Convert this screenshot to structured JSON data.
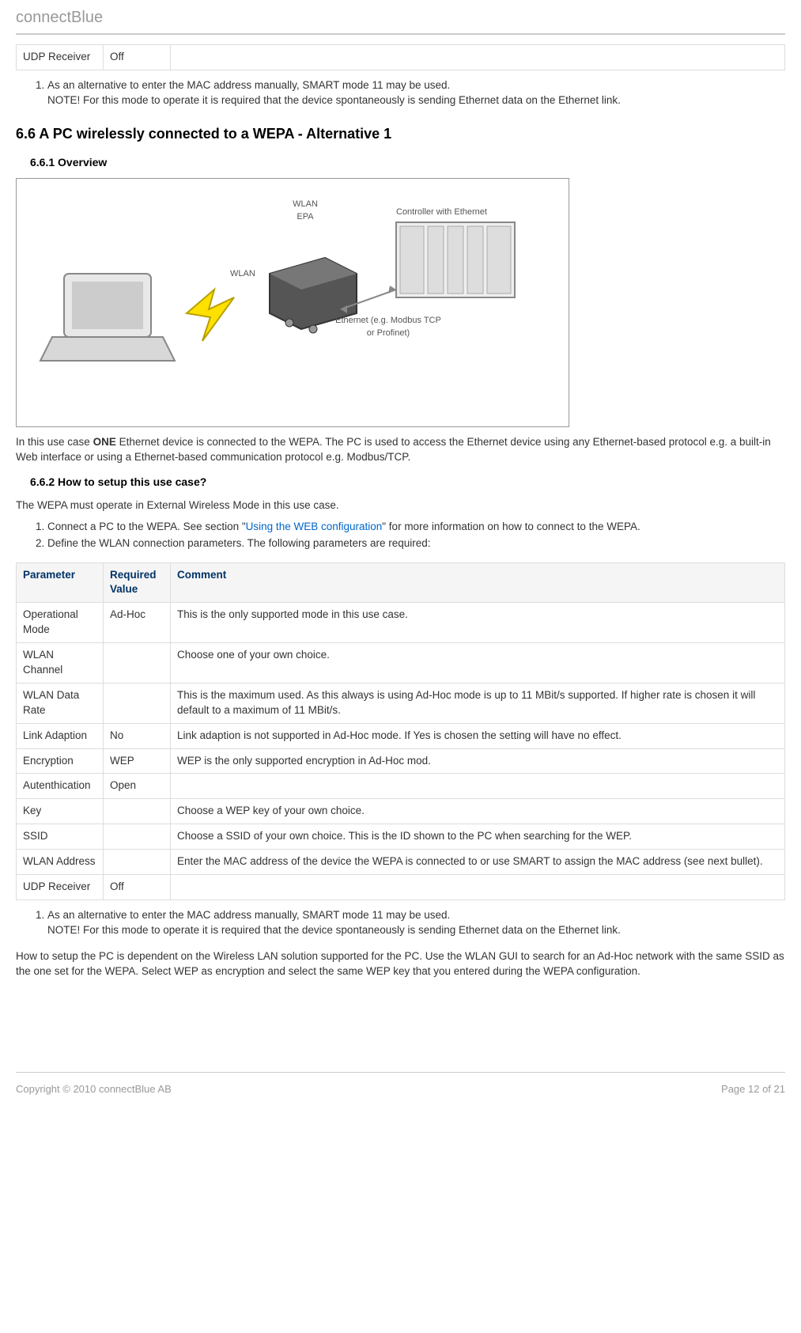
{
  "header": {
    "brand": "connectBlue"
  },
  "table1": {
    "rows": [
      {
        "param": "UDP Receiver",
        "req": "Off",
        "comment": ""
      }
    ]
  },
  "note1": {
    "items": [
      {
        "line1": "As an alternative to enter the MAC address manually, SMART mode 11 may be used.",
        "line2": "NOTE! For this mode to operate it is required that the device spontaneously is sending Ethernet data on the Ethernet link."
      }
    ]
  },
  "section66": {
    "title": "6.6 A PC wirelessly connected to a WEPA - Alternative 1",
    "overview_title": "6.6.1 Overview",
    "diagram": {
      "wlan_epa": "WLAN\nEPA",
      "wlan": "WLAN",
      "controller": "Controller with Ethernet",
      "ethernet": "Ethernet (e.g. Modbus TCP\nor Profinet)"
    },
    "overview_text_pre": "In this use case  ",
    "overview_bold": "ONE",
    "overview_text_post": " Ethernet device is connected to the WEPA. The PC is used to access the Ethernet device using any Ethernet-based protocol e.g. a built-in Web interface or using a Ethernet-based communication protocol e.g. Modbus/TCP.",
    "howto_title": "6.6.2 How to setup this use case?",
    "howto_intro": "The WEPA must operate in External Wireless Mode in this use case.",
    "howto_steps": [
      {
        "pre": "Connect a PC to the WEPA. See section \"",
        "link": "Using the WEB configuration",
        "post": "\" for more information on how to connect to the WEPA."
      },
      {
        "pre": "Define the WLAN connection parameters. The following parameters are required:",
        "link": "",
        "post": ""
      }
    ]
  },
  "table2": {
    "headers": {
      "param": "Parameter",
      "req": "Required Value",
      "comment": "Comment"
    },
    "rows": [
      {
        "param": "Operational Mode",
        "req": "Ad-Hoc",
        "comment": "This is the only supported mode in this use case."
      },
      {
        "param": "WLAN Channel",
        "req": "",
        "comment": "Choose one of your own choice."
      },
      {
        "param": "WLAN Data Rate",
        "req": "",
        "comment": "This is the maximum used. As this always is using Ad-Hoc mode is up to 11 MBit/s supported. If higher rate is chosen it will default to a maximum of 11 MBit/s."
      },
      {
        "param": "Link Adaption",
        "req": "No",
        "comment": "Link adaption is not supported in Ad-Hoc mode. If Yes is chosen the setting will have no effect."
      },
      {
        "param": "Encryption",
        "req": "WEP",
        "comment": "WEP is the only supported encryption in Ad-Hoc mod."
      },
      {
        "param": "Autenthication",
        "req": "Open",
        "comment": ""
      },
      {
        "param": "Key",
        "req": "",
        "comment": "Choose a WEP key of your own choice."
      },
      {
        "param": "SSID",
        "req": "",
        "comment": "Choose a SSID of your own choice. This is the ID shown to the PC when searching for the WEP."
      },
      {
        "param": "WLAN Address",
        "req": "",
        "comment": "Enter the MAC address of the device the WEPA is connected to or use SMART to assign the MAC address (see next bullet)."
      },
      {
        "param": "UDP Receiver",
        "req": "Off",
        "comment": ""
      }
    ]
  },
  "note2": {
    "items": [
      {
        "line1": "As an alternative to enter the MAC address manually, SMART mode 11 may be used.",
        "line2": "NOTE! For this mode to operate it is required that the device spontaneously is sending Ethernet data on the Ethernet link."
      }
    ]
  },
  "pc_setup": "How to setup the PC is dependent on the Wireless LAN solution supported for the PC. Use the WLAN GUI to search for an Ad-Hoc network with the same SSID as the one set for the WEPA. Select WEP as encryption and select the same WEP key that you entered during the WEPA configuration.",
  "footer": {
    "copyright": "Copyright © 2010 connectBlue AB",
    "page": "Page 12 of 21"
  }
}
